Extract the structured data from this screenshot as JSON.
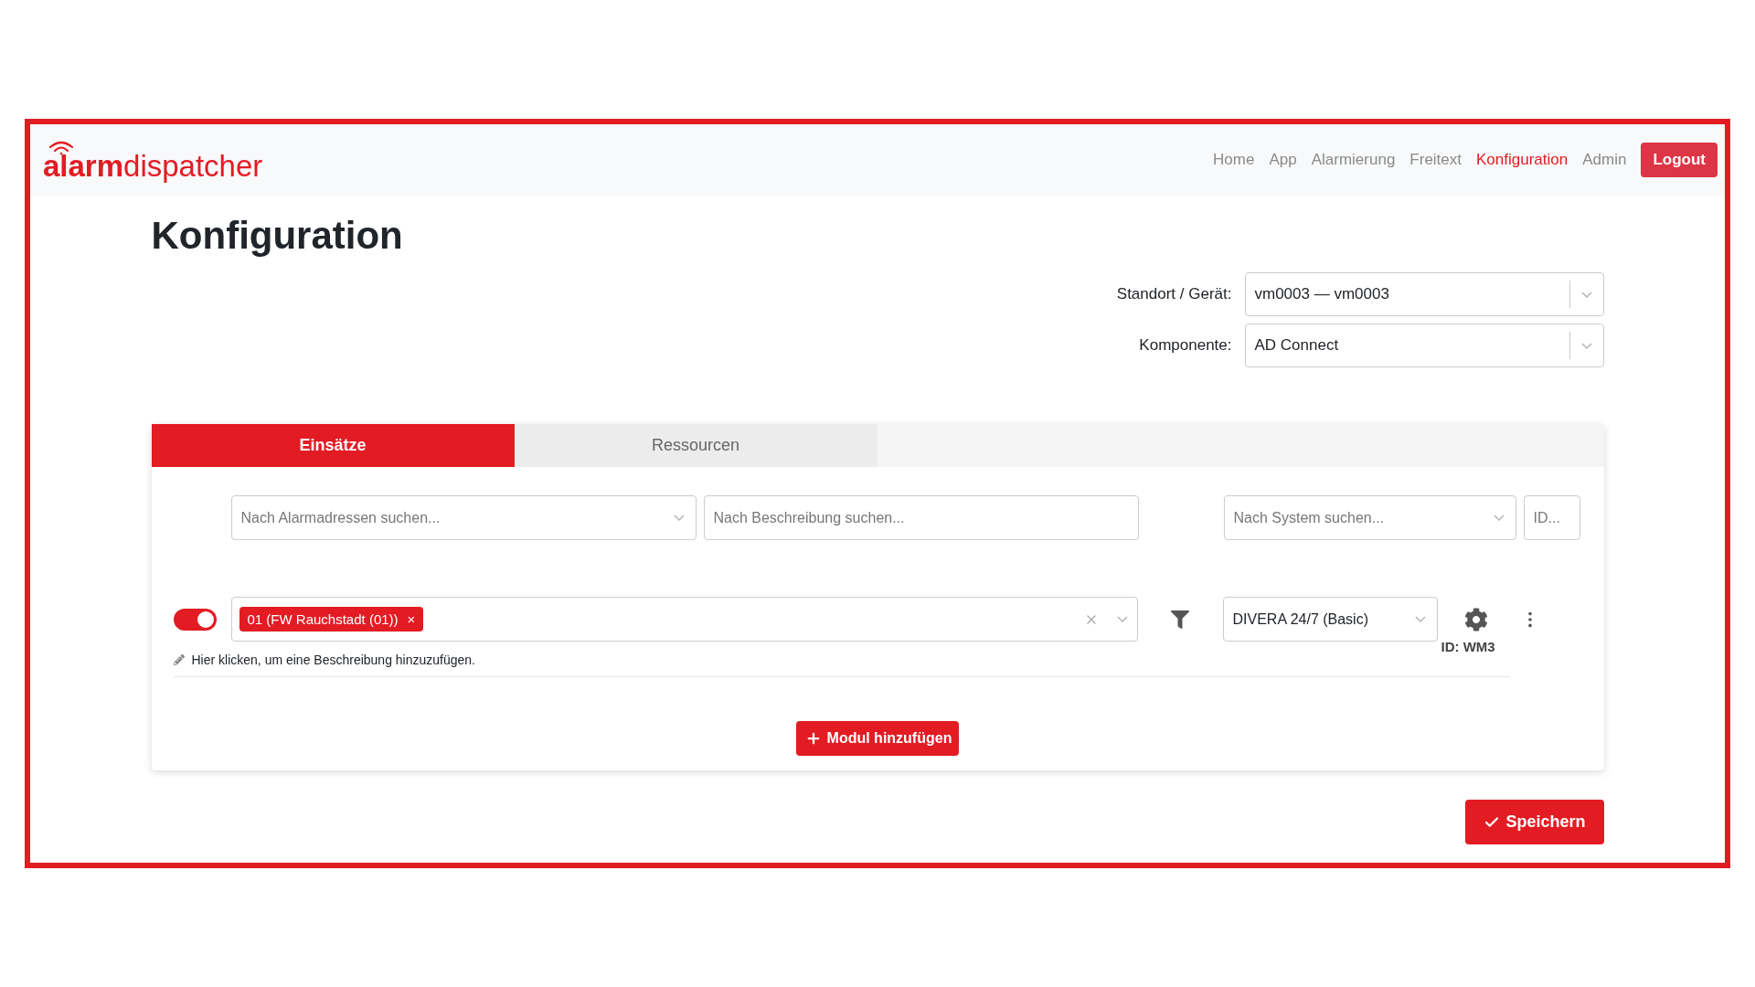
{
  "header": {
    "logo": {
      "bold": "alarm",
      "light": "dispatcher"
    },
    "nav": [
      {
        "label": "Home",
        "selected": false
      },
      {
        "label": "App",
        "selected": false
      },
      {
        "label": "Alarmierung",
        "selected": false
      },
      {
        "label": "Freitext",
        "selected": false
      },
      {
        "label": "Konfiguration",
        "selected": true
      },
      {
        "label": "Admin",
        "selected": false
      }
    ],
    "logout": "Logout"
  },
  "title": "Konfiguration",
  "selectors": [
    {
      "label": "Standort / Gerät:",
      "value": "vm0003 — vm0003"
    },
    {
      "label": "Komponente:",
      "value": "AD Connect"
    }
  ],
  "tabs": [
    {
      "label": "Einsätze",
      "selected": true
    },
    {
      "label": "Ressourcen",
      "selected": false
    }
  ],
  "filters": [
    {
      "kind": "select",
      "placeholder": "Nach Alarmadressen suchen..."
    },
    {
      "kind": "input",
      "placeholder": "Nach Beschreibung suchen..."
    },
    {
      "kind": "select",
      "placeholder": "Nach System suchen..."
    },
    {
      "kind": "input",
      "placeholder": "ID..."
    }
  ],
  "modules": [
    {
      "enabled": true,
      "tags": [
        {
          "label": "01 (FW Rauchstadt (01))",
          "remove": "×"
        }
      ],
      "description": "Hier klicken, um eine Beschreibung hinzuzufügen.",
      "system": "DIVERA 24/7 (Basic)",
      "id_label": "ID: WM3"
    }
  ],
  "add_button": "Modul hinzufügen",
  "save_button": "Speichern"
}
